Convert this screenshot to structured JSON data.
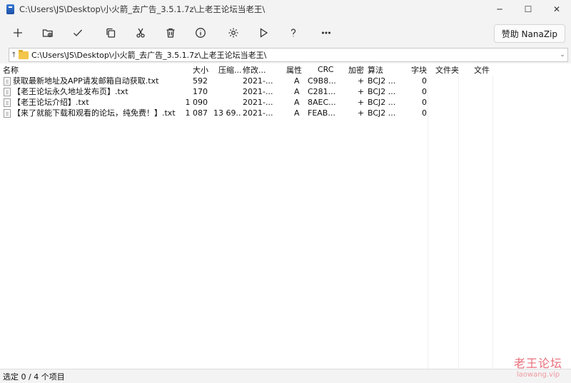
{
  "window": {
    "title": "C:\\Users\\JS\\Desktop\\小火箭_去广告_3.5.1.7z\\上老王论坛当老王\\",
    "minimize": "─",
    "maximize": "☐",
    "close": "✕"
  },
  "toolbar": {
    "buttons": [
      {
        "name": "add-button",
        "icon": "plus-icon"
      },
      {
        "name": "extract-button",
        "icon": "folder-extract-icon"
      },
      {
        "name": "test-button",
        "icon": "check-icon"
      },
      {
        "name": "copy-button",
        "icon": "copy-icon"
      },
      {
        "name": "move-button",
        "icon": "scissors-icon"
      },
      {
        "name": "delete-button",
        "icon": "trash-icon"
      },
      {
        "name": "info-button",
        "icon": "info-icon"
      },
      {
        "name": "settings-button",
        "icon": "gear-icon"
      },
      {
        "name": "benchmark-button",
        "icon": "play-icon"
      },
      {
        "name": "help-button",
        "icon": "question-icon"
      },
      {
        "name": "more-button",
        "icon": "ellipsis-icon"
      }
    ],
    "sponsor_label": "赞助 NanaZip"
  },
  "address": {
    "path": "C:\\Users\\JS\\Desktop\\小火箭_去广告_3.5.1.7z\\上老王论坛当老王\\"
  },
  "columns": {
    "name": "名称",
    "size": "大小",
    "packed": "压缩...",
    "modified": "修改...",
    "attributes": "属性",
    "crc": "CRC",
    "encrypted": "加密",
    "method": "算法",
    "block": "字块",
    "folders": "文件夹",
    "files": "文件"
  },
  "rows": [
    {
      "name": "获取最新地址及APP请发邮箱自动获取.txt",
      "size": "592",
      "packed": "",
      "modified": "2021-...",
      "attributes": "A",
      "crc": "C9B8...",
      "encrypted": "+",
      "method": "BCJ2 ...",
      "block": "0"
    },
    {
      "name": "【老王论坛永久地址发布页】.txt",
      "size": "170",
      "packed": "",
      "modified": "2021-...",
      "attributes": "A",
      "crc": "C281...",
      "encrypted": "+",
      "method": "BCJ2 ...",
      "block": "0"
    },
    {
      "name": "【老王论坛介绍】.txt",
      "size": "1 090",
      "packed": "",
      "modified": "2021-...",
      "attributes": "A",
      "crc": "8AEC...",
      "encrypted": "+",
      "method": "BCJ2 ...",
      "block": "0"
    },
    {
      "name": "【来了就能下载和观看的论坛，纯免费！】.txt",
      "size": "1 087",
      "packed": "13 69...",
      "modified": "2021-...",
      "attributes": "A",
      "crc": "FEAB...",
      "encrypted": "+",
      "method": "BCJ2 ...",
      "block": "0"
    }
  ],
  "status": {
    "text": "选定 0 / 4 个项目"
  },
  "watermark": {
    "title": "老王论坛",
    "subtitle": "laowang.vip"
  }
}
